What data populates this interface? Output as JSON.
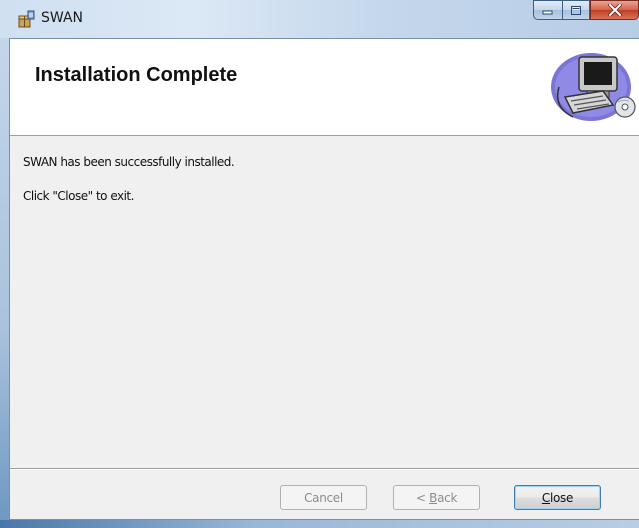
{
  "window": {
    "title": "SWAN",
    "icon": "installer-package-icon",
    "controls": [
      "minimize-icon",
      "maximize-icon",
      "close-icon"
    ]
  },
  "banner": {
    "heading": "Installation Complete",
    "graphic": "computer-with-disc-icon"
  },
  "body": {
    "message": "SWAN has been successfully installed.",
    "instruction": "Click \"Close\" to exit."
  },
  "buttons": {
    "cancel": {
      "label": "Cancel",
      "enabled": false
    },
    "back": {
      "prefix": "< ",
      "mnemonic": "B",
      "rest": "ack",
      "enabled": false
    },
    "close": {
      "mnemonic": "C",
      "rest": "lose",
      "enabled": true,
      "default": true
    }
  },
  "colors": {
    "close_button_red": "#c23d22",
    "client_background": "#f0f0f0",
    "banner_background": "#ffffff"
  }
}
